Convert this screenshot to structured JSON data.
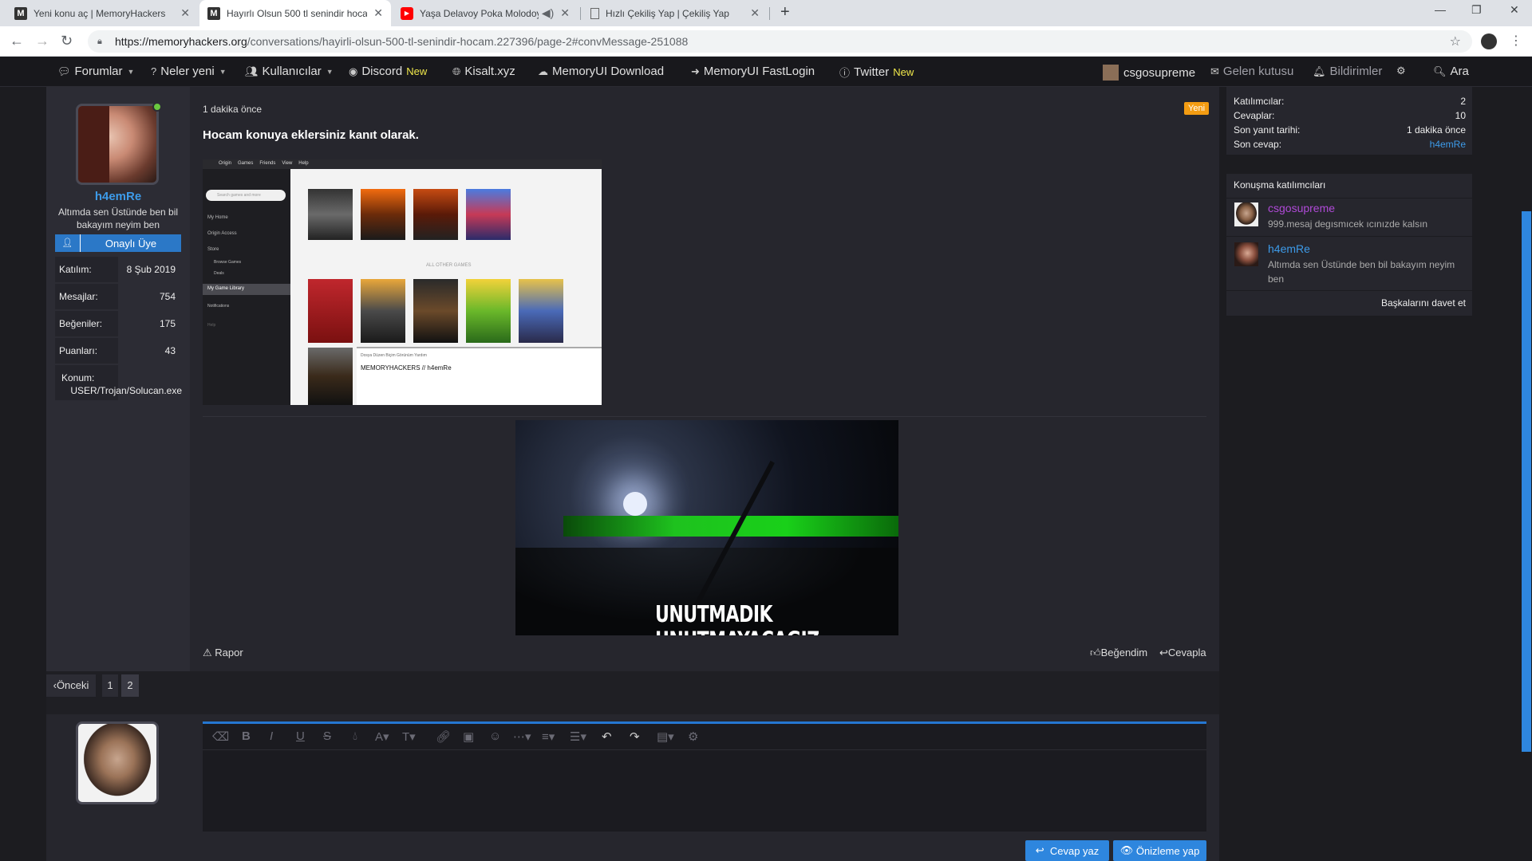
{
  "browser": {
    "tabs": [
      {
        "title": "Yeni konu aç | MemoryHackers",
        "favicon": "memoryhackers-icon"
      },
      {
        "title": "Hayırlı Olsun 500 tl senindir hoca",
        "favicon": "memoryhackers-icon"
      },
      {
        "title": "Yaşa Delavoy Poka Molodoy",
        "favicon": "youtube-icon"
      },
      {
        "title": "Hızlı Çekiliş Yap | Çekiliş Yap",
        "favicon": "document-icon"
      }
    ],
    "url_domain": "https://memoryhackers.org",
    "url_path": "/conversations/hayirli-olsun-500-tl-senindir-hocam.227396/page-2#convMessage-251088"
  },
  "nav": {
    "forumlar": "Forumlar",
    "neler_yeni": "Neler yeni",
    "kullanicilar": "Kullanıcılar",
    "discord": "Discord",
    "discord_new": "New",
    "kisalt": "Kisalt.xyz",
    "memoryui_download": "MemoryUI Download",
    "memoryui_fastlogin": "MemoryUI FastLogin",
    "twitter": "Twitter",
    "twitter_new": "New",
    "username": "csgosupreme",
    "inbox": "Gelen kutusu",
    "alerts": "Bildirimler",
    "search": "Ara"
  },
  "author": {
    "name": "h4emRe",
    "title": "Altımda sen Üstünde ben bil bakayım neyim ben",
    "banner": "Onaylı Üye",
    "stats": [
      {
        "label": "Katılım:",
        "value": "8 Şub 2019"
      },
      {
        "label": "Mesajlar:",
        "value": "754"
      },
      {
        "label": "Beğeniler:",
        "value": "175"
      },
      {
        "label": "Puanları:",
        "value": "43"
      }
    ],
    "location_label": "Konum:",
    "location_value": "USER/Trojan/Solucan.exe"
  },
  "post": {
    "time": "1 dakika önce",
    "badge": "Yeni",
    "text": "Hocam konuya eklersiniz kanıt olarak.",
    "screenshot": {
      "menu": [
        "Origin",
        "Games",
        "Friends",
        "View",
        "Help"
      ],
      "search_placeholder": "Search games and more",
      "side_items": [
        "My Home",
        "Origin Access",
        "Store",
        "Browse Games",
        "Deals",
        "My Game Library",
        "Notifications",
        "Help"
      ],
      "all_games": "ALL OTHER GAMES",
      "notepad_title": "MEMORYHACKERS // h4emRe",
      "notepad_menu": "Dosya  Düzen  Biçim  Görünüm  Yardım",
      "covers": [
        "BATTLEFIELD 3",
        "BATTLEFIELD 4",
        "BATTLEFIELD 1",
        "BATTLEFIELD V",
        "APEX LEGENDS",
        "BATTLEFIELD HARDLINE",
        "DEAD SPACE",
        "PLANTS vs ZOMBIES",
        "SIMCITY 2000",
        "TITANFALL"
      ]
    },
    "gif_caption": "UNUTMADIK UNUTMAYACAGIZ.",
    "report": "Rapor",
    "like": "Beğendim",
    "reply": "Cevapla"
  },
  "pager": {
    "prev": "Önceki",
    "pages": [
      "1",
      "2"
    ],
    "current": "2"
  },
  "reply_box": {
    "submit": "Cevap yaz",
    "preview": "Önizleme yap"
  },
  "sidebar": {
    "info": [
      {
        "label": "Katılımcılar:",
        "value": "2"
      },
      {
        "label": "Cevaplar:",
        "value": "10"
      },
      {
        "label": "Son yanıt tarihi:",
        "value": "1 dakika önce"
      },
      {
        "label": "Son cevap:",
        "value": "h4emRe"
      }
    ],
    "participants_title": "Konuşma katılımcıları",
    "participants": [
      {
        "name": "csgosupreme",
        "sub": "999.mesaj degısmıcek ıcınızde kalsın",
        "color": "#b04ad8"
      },
      {
        "name": "h4emRe",
        "sub": "Altımda sen Üstünde ben bil bakayım neyim ben",
        "color": "#3d9be9"
      }
    ],
    "invite": "Başkalarını davet et"
  }
}
